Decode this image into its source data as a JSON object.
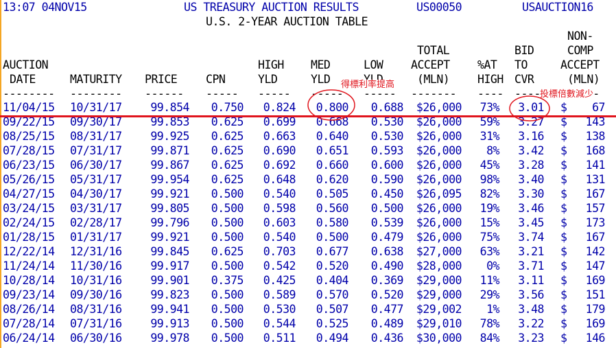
{
  "banner": {
    "time_date": "13:07 04NOV15",
    "title": "US TREASURY AUCTION RESULTS",
    "code1": "US00050",
    "code2": "USAUCTION16",
    "subtitle": "U.S. 2-YEAR AUCTION TABLE"
  },
  "headers": {
    "auction": [
      "AUCTION",
      "DATE"
    ],
    "maturity": "MATURITY",
    "price": "PRICE",
    "cpn": "CPN",
    "high": [
      "HIGH",
      "YLD"
    ],
    "med": [
      "MED",
      "YLD"
    ],
    "low": [
      "LOW",
      "YLD"
    ],
    "total": [
      "TOTAL",
      "ACCEPT",
      "(MLN)"
    ],
    "pct": [
      "%AT",
      "HIGH"
    ],
    "bid": [
      "BID",
      "TO",
      "CVR"
    ],
    "noncomp": [
      "NON-",
      "COMP",
      "ACCEPT",
      "(MLN)"
    ]
  },
  "dashes": {
    "auction": "--------",
    "maturity": "--------",
    "price": "------",
    "cpn": "-----",
    "high": "-----",
    "med": "-----",
    "low": "-----",
    "total": "-------",
    "pct": "----",
    "bid": "----",
    "noncomp": "------"
  },
  "annotations": {
    "med_yld": "得標利率提高",
    "bid_cvr": "投標倍數減少"
  },
  "rows": [
    {
      "date": "11/04/15",
      "maturity": "10/31/17",
      "price": "99.854",
      "cpn": "0.750",
      "high": "0.824",
      "med": "0.800",
      "low": "0.688",
      "total": "$26,000",
      "pct": "73%",
      "bid": "3.01",
      "nc_cur": "$",
      "nc": "67"
    },
    {
      "date": "09/22/15",
      "maturity": "09/30/17",
      "price": "99.853",
      "cpn": "0.625",
      "high": "0.699",
      "med": "0.668",
      "low": "0.530",
      "total": "$26,000",
      "pct": "59%",
      "bid": "3.27",
      "nc_cur": "$",
      "nc": "143"
    },
    {
      "date": "08/25/15",
      "maturity": "08/31/17",
      "price": "99.925",
      "cpn": "0.625",
      "high": "0.663",
      "med": "0.640",
      "low": "0.530",
      "total": "$26,000",
      "pct": "31%",
      "bid": "3.16",
      "nc_cur": "$",
      "nc": "138"
    },
    {
      "date": "07/28/15",
      "maturity": "07/31/17",
      "price": "99.871",
      "cpn": "0.625",
      "high": "0.690",
      "med": "0.651",
      "low": "0.593",
      "total": "$26,000",
      "pct": "8%",
      "bid": "3.42",
      "nc_cur": "$",
      "nc": "168"
    },
    {
      "date": "06/23/15",
      "maturity": "06/30/17",
      "price": "99.867",
      "cpn": "0.625",
      "high": "0.692",
      "med": "0.660",
      "low": "0.600",
      "total": "$26,000",
      "pct": "45%",
      "bid": "3.28",
      "nc_cur": "$",
      "nc": "141"
    },
    {
      "date": "05/26/15",
      "maturity": "05/31/17",
      "price": "99.954",
      "cpn": "0.625",
      "high": "0.648",
      "med": "0.620",
      "low": "0.590",
      "total": "$26,000",
      "pct": "98%",
      "bid": "3.40",
      "nc_cur": "$",
      "nc": "131"
    },
    {
      "date": "04/27/15",
      "maturity": "04/30/17",
      "price": "99.921",
      "cpn": "0.500",
      "high": "0.540",
      "med": "0.505",
      "low": "0.450",
      "total": "$26,095",
      "pct": "82%",
      "bid": "3.30",
      "nc_cur": "$",
      "nc": "167"
    },
    {
      "date": "03/24/15",
      "maturity": "03/31/17",
      "price": "99.805",
      "cpn": "0.500",
      "high": "0.598",
      "med": "0.560",
      "low": "0.500",
      "total": "$26,000",
      "pct": "19%",
      "bid": "3.46",
      "nc_cur": "$",
      "nc": "157"
    },
    {
      "date": "02/24/15",
      "maturity": "02/28/17",
      "price": "99.796",
      "cpn": "0.500",
      "high": "0.603",
      "med": "0.580",
      "low": "0.539",
      "total": "$26,000",
      "pct": "15%",
      "bid": "3.45",
      "nc_cur": "$",
      "nc": "173"
    },
    {
      "date": "01/28/15",
      "maturity": "01/31/17",
      "price": "99.921",
      "cpn": "0.500",
      "high": "0.540",
      "med": "0.500",
      "low": "0.479",
      "total": "$26,000",
      "pct": "75%",
      "bid": "3.74",
      "nc_cur": "$",
      "nc": "167"
    },
    {
      "date": "12/22/14",
      "maturity": "12/31/16",
      "price": "99.845",
      "cpn": "0.625",
      "high": "0.703",
      "med": "0.677",
      "low": "0.638",
      "total": "$27,000",
      "pct": "63%",
      "bid": "3.21",
      "nc_cur": "$",
      "nc": "142"
    },
    {
      "date": "11/24/14",
      "maturity": "11/30/16",
      "price": "99.917",
      "cpn": "0.500",
      "high": "0.542",
      "med": "0.520",
      "low": "0.490",
      "total": "$28,000",
      "pct": "0%",
      "bid": "3.71",
      "nc_cur": "$",
      "nc": "147"
    },
    {
      "date": "10/28/14",
      "maturity": "10/31/16",
      "price": "99.901",
      "cpn": "0.375",
      "high": "0.425",
      "med": "0.404",
      "low": "0.369",
      "total": "$29,000",
      "pct": "11%",
      "bid": "3.11",
      "nc_cur": "$",
      "nc": "169"
    },
    {
      "date": "09/23/14",
      "maturity": "09/30/16",
      "price": "99.823",
      "cpn": "0.500",
      "high": "0.589",
      "med": "0.570",
      "low": "0.520",
      "total": "$29,000",
      "pct": "29%",
      "bid": "3.56",
      "nc_cur": "$",
      "nc": "151"
    },
    {
      "date": "08/26/14",
      "maturity": "08/31/16",
      "price": "99.941",
      "cpn": "0.500",
      "high": "0.530",
      "med": "0.507",
      "low": "0.477",
      "total": "$29,002",
      "pct": "1%",
      "bid": "3.48",
      "nc_cur": "$",
      "nc": "179"
    },
    {
      "date": "07/28/14",
      "maturity": "07/31/16",
      "price": "99.913",
      "cpn": "0.500",
      "high": "0.544",
      "med": "0.525",
      "low": "0.489",
      "total": "$29,010",
      "pct": "78%",
      "bid": "3.22",
      "nc_cur": "$",
      "nc": "169"
    },
    {
      "date": "06/24/14",
      "maturity": "06/30/16",
      "price": "99.978",
      "cpn": "0.500",
      "high": "0.511",
      "med": "0.494",
      "low": "0.436",
      "total": "$30,000",
      "pct": "84%",
      "bid": "3.23",
      "nc_cur": "$",
      "nc": "146"
    }
  ]
}
